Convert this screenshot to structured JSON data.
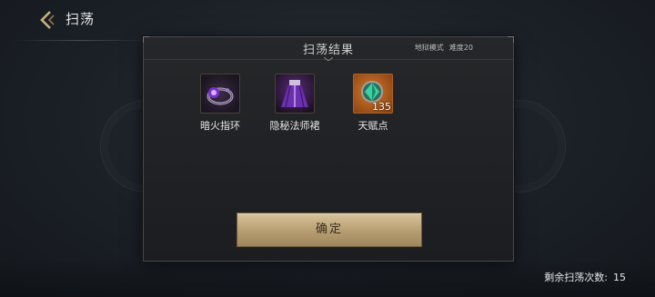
{
  "header": {
    "title": "扫荡",
    "back_icon": "chevron-left-icon"
  },
  "dialog": {
    "title": "扫荡结果",
    "mode": "地狱模式",
    "difficulty": "难度20",
    "items": [
      {
        "name": "暗火指环",
        "icon": "ring-icon",
        "count": ""
      },
      {
        "name": "隐秘法师裙",
        "icon": "skirt-icon",
        "count": ""
      },
      {
        "name": "天赋点",
        "icon": "gem-icon",
        "count": "135"
      }
    ],
    "confirm_label": "确定"
  },
  "footer": {
    "remaining_label": "剩余扫荡次数:",
    "remaining_value": "15"
  },
  "colors": {
    "button": "#c2aa7e",
    "background": "#1b2027",
    "panel": "#212326"
  }
}
